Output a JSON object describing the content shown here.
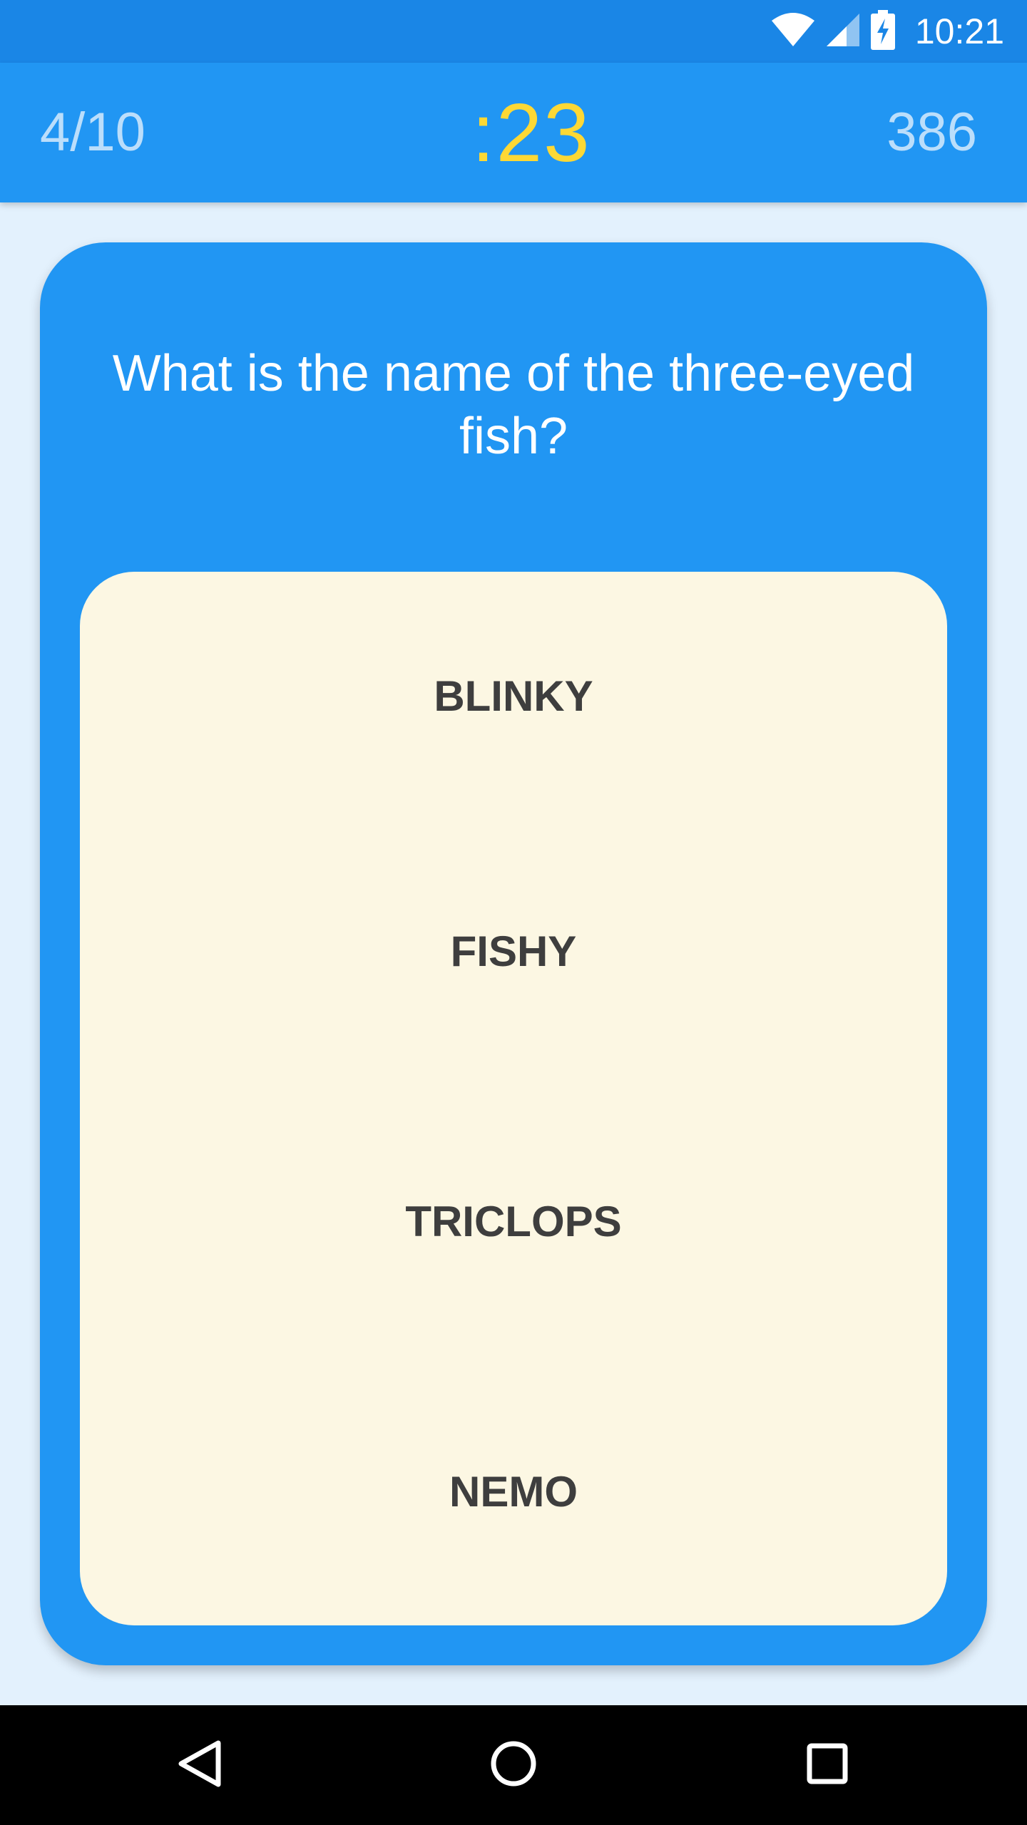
{
  "status_bar": {
    "time": "10:21",
    "icons": [
      "wifi-icon",
      "signal-icon",
      "battery-charging-icon"
    ]
  },
  "header": {
    "progress": "4/10",
    "timer": ":23",
    "score": "386"
  },
  "question": {
    "text": "What is the name of the three-eyed fish?"
  },
  "answers": [
    {
      "label": "BLINKY"
    },
    {
      "label": "FISHY"
    },
    {
      "label": "TRICLOPS"
    },
    {
      "label": "NEMO"
    }
  ],
  "nav_bar": {
    "icons": [
      "back-icon",
      "home-icon",
      "recents-icon"
    ]
  },
  "colors": {
    "status_bar": "#1A86E6",
    "app_bar": "#2196F3",
    "timer": "#FDD835",
    "background": "#E3F1FD",
    "answer_panel": "#FCF7E3"
  }
}
